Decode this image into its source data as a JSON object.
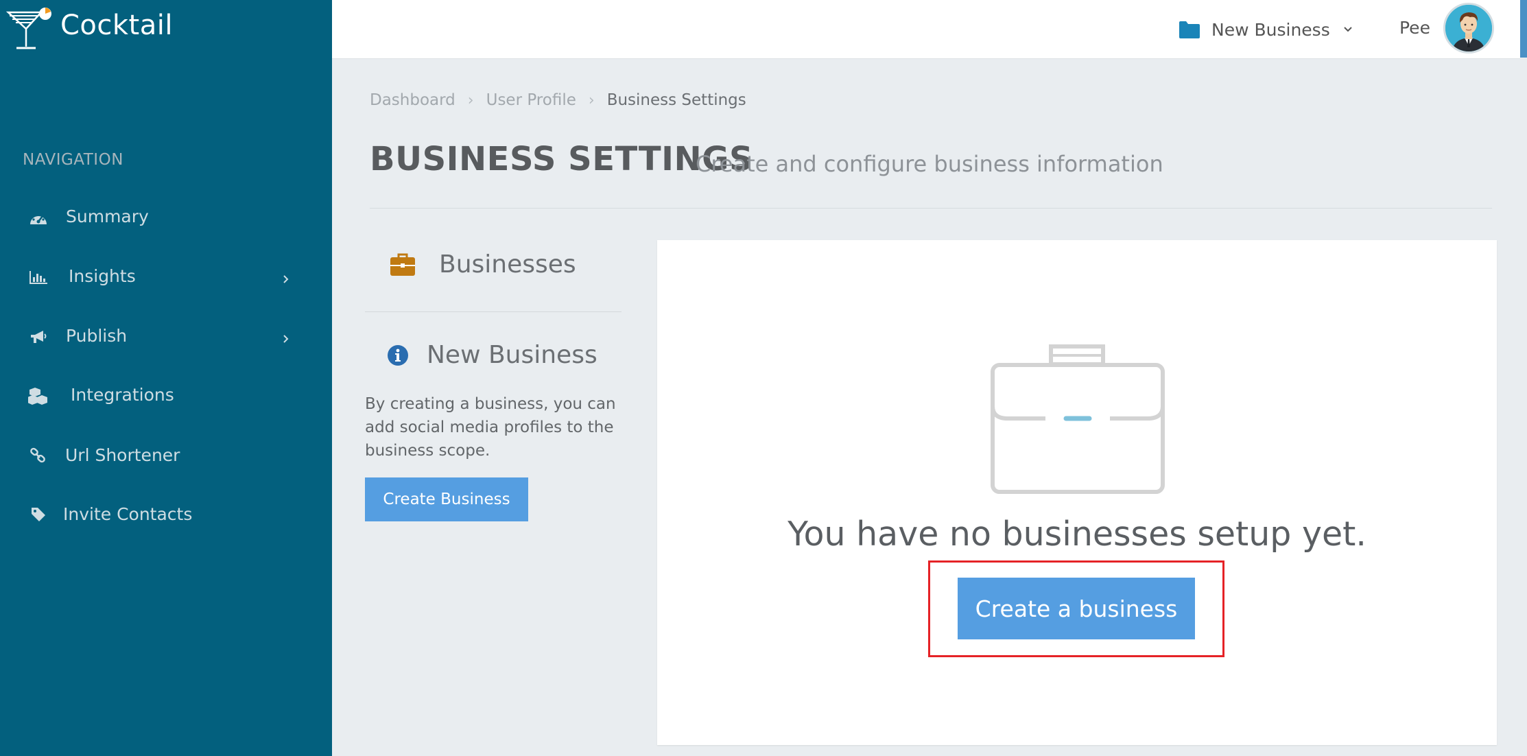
{
  "brand": {
    "name": "Cocktail"
  },
  "sidebar": {
    "heading": "NAVIGATION",
    "items": [
      {
        "label": "Summary",
        "icon": "dashboard-icon",
        "has_submenu": false
      },
      {
        "label": "Insights",
        "icon": "bar-chart-icon",
        "has_submenu": true
      },
      {
        "label": "Publish",
        "icon": "megaphone-icon",
        "has_submenu": true
      },
      {
        "label": "Integrations",
        "icon": "cubes-icon",
        "has_submenu": false
      },
      {
        "label": "Url Shortener",
        "icon": "link-icon",
        "has_submenu": false
      },
      {
        "label": "Invite Contacts",
        "icon": "tag-icon",
        "has_submenu": false
      }
    ]
  },
  "topbar": {
    "business_selector": "New Business",
    "user_name": "Pee"
  },
  "breadcrumb": [
    "Dashboard",
    "User Profile",
    "Business Settings"
  ],
  "page": {
    "title": "BUSINESS SETTINGS",
    "subtitle": "Create and configure business information"
  },
  "left_panel": {
    "businesses_label": "Businesses",
    "new_business_label": "New Business",
    "description": "By creating a business, you can add social media profiles to the business scope.",
    "create_button": "Create Business"
  },
  "empty_state": {
    "message": "You have no businesses setup yet.",
    "cta_button": "Create a business"
  },
  "colors": {
    "sidebar_bg": "#03607e",
    "button_blue": "#559ee1",
    "highlight_red": "#e52226",
    "briefcase_orange": "#c07a12"
  }
}
